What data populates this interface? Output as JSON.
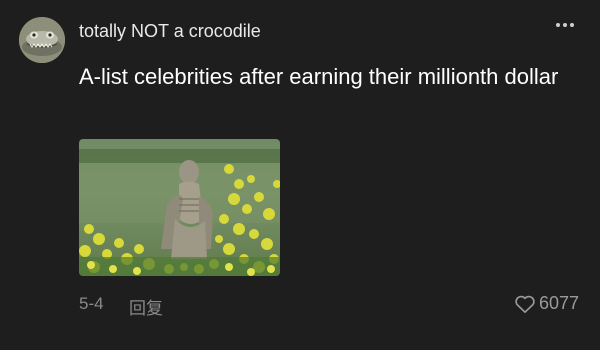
{
  "comment": {
    "username": "totally NOT a crocodile",
    "text": "A-list celebrities after earning their millionth dollar",
    "date": "5-4",
    "reply_label": "回复",
    "like_count": "6077"
  },
  "icons": {
    "more": "more-dots-icon",
    "like": "heart-outline-icon"
  },
  "colors": {
    "background": "#1e1e1e",
    "text_primary": "#ffffff",
    "text_secondary": "#8a8a8a"
  }
}
